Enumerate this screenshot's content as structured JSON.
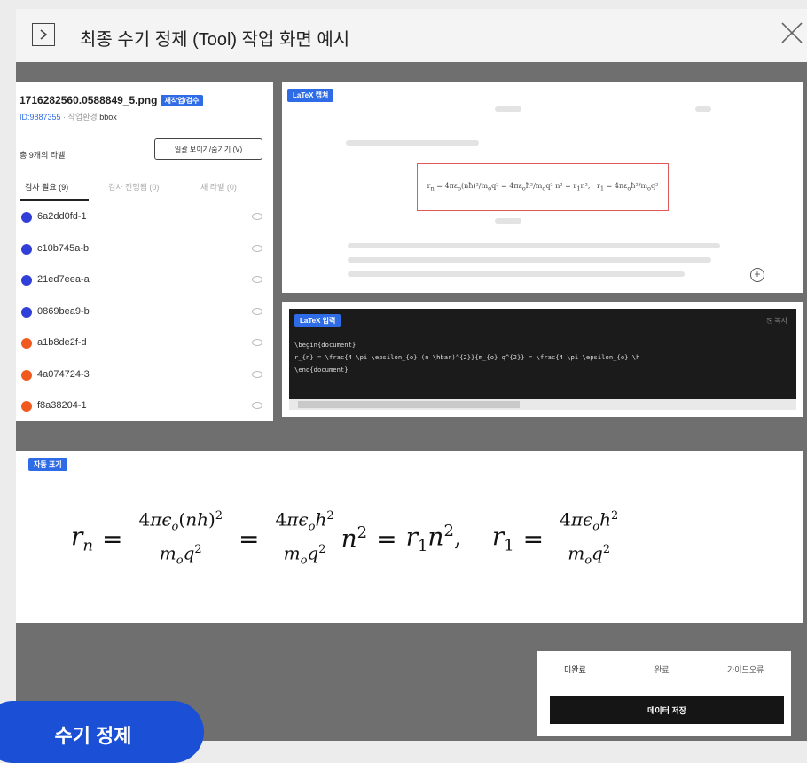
{
  "window": {
    "title": "최종 수기 정제 (Tool) 작업 화면 예시"
  },
  "file": {
    "name": "1716282560.0588849_5.png",
    "status_tag": "재작업/검수",
    "id": "ID:9887355",
    "task_label": "작업환경",
    "task_value": "bbox"
  },
  "labels": {
    "total": "총 9개의 라벨",
    "toggle_button": "일괄 보이기/숨기기 (V)",
    "tabs": [
      "검사 필요 (9)",
      "검사 진행됨 (0)",
      "새 라벨 (0)"
    ],
    "items": [
      {
        "id": "6a2dd0fd-1",
        "color": "#2f3fd8"
      },
      {
        "id": "c10b745a-b",
        "color": "#2f3fd8"
      },
      {
        "id": "21ed7eea-a",
        "color": "#2f3fd8"
      },
      {
        "id": "0869bea9-b",
        "color": "#2f3fd8"
      },
      {
        "id": "a1b8de2f-d",
        "color": "#f15a1e"
      },
      {
        "id": "4a074724-3",
        "color": "#f15a1e"
      },
      {
        "id": "f8a38204-1",
        "color": "#f15a1e"
      }
    ]
  },
  "image_panel": {
    "badge": "LaTeX 캡쳐",
    "zoom_icon": "plus-circle-icon"
  },
  "code_panel": {
    "badge": "LaTeX 입력",
    "copy": "⎘ 복사",
    "lines": [
      "\\begin{document}",
      "r_{n} = \\frac{4 \\pi \\epsilon_{o} (n \\hbar)^{2}}{m_{o} q^{2}} = \\frac{4 \\pi \\epsilon_{o} \\h",
      "\\end{document}"
    ]
  },
  "render_panel": {
    "badge": "자동 표기"
  },
  "controls": {
    "tabs": [
      "미완료",
      "완료",
      "가이드오류"
    ],
    "save": "데이터 저장"
  },
  "overlay": {
    "label": "수기 정제"
  },
  "colors": {
    "accent": "#2e6be6",
    "stage": "#6f6f6f",
    "pill": "#1a4fd6"
  }
}
